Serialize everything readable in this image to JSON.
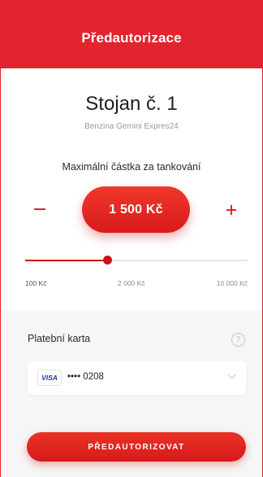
{
  "header": {
    "title": "Předautorizace"
  },
  "station": {
    "name": "Stojan č. 1",
    "subtitle": "Benzina Gemini Expres24"
  },
  "amount": {
    "label": "Maximální částka za tankování",
    "value_text": "1 500 Kč",
    "minus_label": "−",
    "plus_label": "+",
    "value": 1500,
    "min": 100,
    "max": 10000,
    "slider_fraction": 0.37
  },
  "slider": {
    "ticks": [
      "100 Kč",
      "2 000 Kč",
      "10 000 Kč"
    ]
  },
  "payment": {
    "label": "Platební karta",
    "help_glyph": "?",
    "card_brand": "VISA",
    "card_number": "•••• 0208"
  },
  "cta": {
    "label": "PŘEDAUTORIZOVAT"
  },
  "colors": {
    "accent": "#e3232d",
    "panel": "#f6f6f6",
    "visa": "#1a3d8f"
  },
  "icons": [
    "minus-icon",
    "plus-icon",
    "help-icon",
    "chevron-down-icon",
    "visa-logo-icon"
  ]
}
